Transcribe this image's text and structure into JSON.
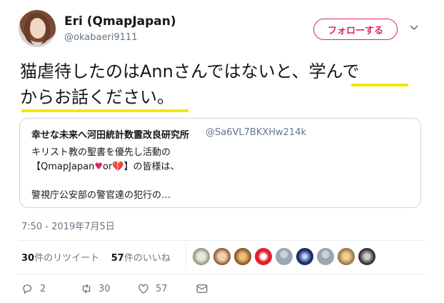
{
  "user": {
    "name": "Eri (QmapJapan)",
    "handle": "@okabaeri9111",
    "follow_label": "フォローする"
  },
  "tweet": {
    "line1": "猫虐待したのはAnnさんではないと、学んで",
    "line2": "からお話ください。"
  },
  "quote": {
    "name": "幸せな未来へ河田統計数霊改良研究所",
    "handle": "@Sa6VL7BKXHw214k",
    "line1": "キリスト教の聖書を優先し活動の",
    "line2_a": "【QmapJapan",
    "heart1": "♥",
    "line2_or": "or",
    "heart2": "💔",
    "line2_b": "】の皆様は、",
    "line3": "警視庁公安部の警官達の犯行の…"
  },
  "timestamp": "7:50 - 2019年7月5日",
  "stats": {
    "retweets_count": "30",
    "retweets_label": "件のリツイート",
    "likes_count": "57",
    "likes_label": "件のいいね"
  },
  "actions": {
    "reply_count": "2",
    "retweet_count": "30",
    "like_count": "57"
  },
  "colors": {
    "accent": "#e0245e",
    "highlight": "#f5e700",
    "muted": "#657786"
  }
}
